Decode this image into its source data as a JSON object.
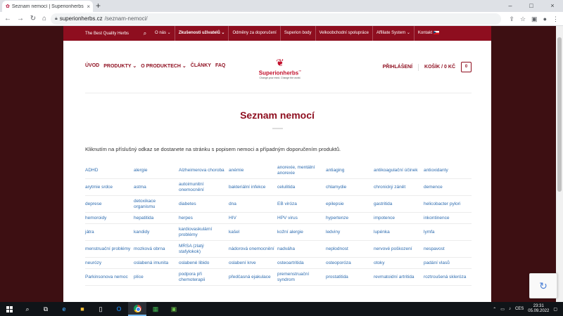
{
  "browser": {
    "tab_title": "Seznam nemocí | Superionherbs",
    "tab_close": "×",
    "new_tab": "+",
    "url_domain": "superionherbs.cz",
    "url_path": "/seznam-nemoci/",
    "window_controls": [
      "–",
      "□",
      "×"
    ]
  },
  "topbar": {
    "tagline": "The Best Quality Herbs",
    "links": [
      "O nás",
      "Zkušenosti uživatelů",
      "Odměny za doporučení",
      "Superion body",
      "Velkoobchodní spolupráce",
      "Affiliate System",
      "Kontakt"
    ]
  },
  "header": {
    "nav": [
      "ÚVOD",
      "PRODUKTY",
      "O PRODUKTECH",
      "ČLÁNKY",
      "FAQ"
    ],
    "logo_name": "Superionherbs",
    "logo_slogan": "Change your mind. Change the world.",
    "login": "PŘIHLÁŠENÍ",
    "cart": "KOŠÍK / 0 KČ",
    "cart_count": "0"
  },
  "page": {
    "title": "Seznam nemocí",
    "intro": "Kliknutím na příslušný odkaz se dostanete na stránku s popisem nemoci a případným doporučením produktů."
  },
  "diseases": [
    [
      "ADHD",
      "alergie",
      "Alzheimerova choroba",
      "anémie",
      "anorexie, mentální anorexie",
      "antiaging",
      "antikoagulační účinek",
      "antioxidanty"
    ],
    [
      "arytmie srdce",
      "astma",
      "autoimunitní onemocnění",
      "bakteriální infekce",
      "celulitida",
      "chlamydie",
      "chronický zánět",
      "demence"
    ],
    [
      "deprese",
      "detoxikace organismu",
      "diabetes",
      "dna",
      "EB viróza",
      "epilepsie",
      "gastritida",
      "helicobacter pylori"
    ],
    [
      "hemoroidy",
      "hepatitida",
      "herpes",
      "HIV",
      "HPV virus",
      "hypertenze",
      "impotence",
      "inkontinence"
    ],
    [
      "játra",
      "kandidy",
      "kardiovaskulární problémy",
      "kašel",
      "kožní alergie",
      "ledviny",
      "lupénka",
      "lymfa"
    ],
    [
      "menstruační problémy",
      "mozková obrna",
      "MRSA (zlatý stafylokok)",
      "nádorová onemocnění",
      "nadváha",
      "neplodnost",
      "nervové poškození",
      "nespavost"
    ],
    [
      "neurózy",
      "oslabená imunita",
      "oslabené libido",
      "oslabení krve",
      "osteoartritida",
      "osteoporóza",
      "otoky",
      "padání vlasů"
    ],
    [
      "Parkinsonova nemoc",
      "plíce",
      "podpora při chemoterapii",
      "předčasná ejakulace",
      "premenstruační syndrom",
      "prostatitida",
      "revmatoidní artritida",
      "roztroušená skleróza"
    ]
  ],
  "taskbar": {
    "lang": "CES",
    "time": "23:31",
    "date": "05.09.2022"
  }
}
